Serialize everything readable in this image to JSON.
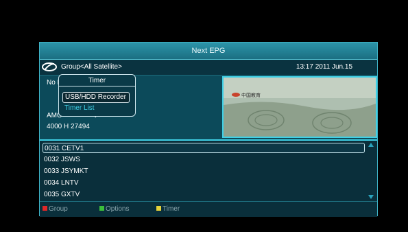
{
  "epg": {
    "title": "Next EPG",
    "group": "Group<All Satellite>",
    "datetime": "13:17 2011 Jun.15",
    "info": {
      "line1": "No I",
      "line2": "AMO",
      "line2b": "V",
      "line3": "4000 H 27494"
    },
    "channels": [
      {
        "label": "0031  CETV1"
      },
      {
        "label": "0032  JSWS"
      },
      {
        "label": "0033  JSYMKT"
      },
      {
        "label": "0034  LNTV"
      },
      {
        "label": "0035  GXTV"
      }
    ],
    "footer": {
      "group_label": "Group",
      "options_label": "Options",
      "timer_label": "Timer",
      "group_color": "#e02828",
      "options_color": "#3bbf3b",
      "timer_color": "#e6d23a"
    }
  },
  "timer_popup": {
    "title": "Timer",
    "items": [
      "USB/HDD Recorder",
      "Timer List"
    ]
  },
  "preview": {
    "logo_text": "中国教育",
    "accent": "#3fd0e6"
  }
}
